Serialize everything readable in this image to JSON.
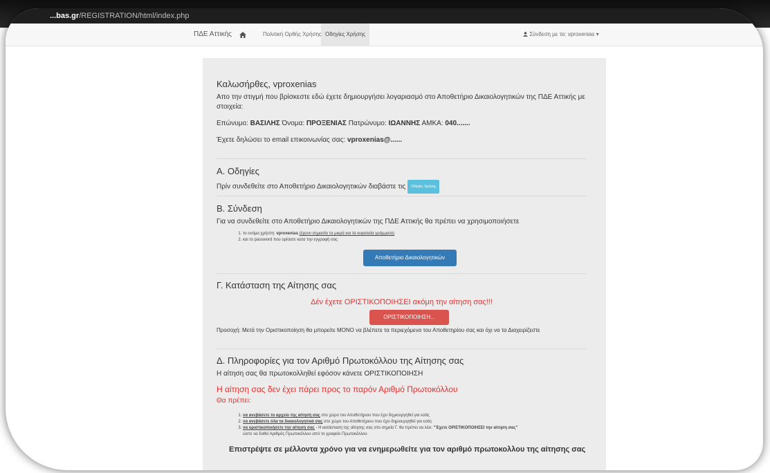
{
  "browser": {
    "url_domain": "...bas.gr",
    "url_path": "/REGISTRATION/html/index.php"
  },
  "navbar": {
    "brand": "ΠΔΕ Αττικής",
    "item_policy": "Πολιτική Ορθής Χρήσης",
    "item_guide": "Οδηγίες Χρήσης",
    "user": "Σύνδεση με τα: vproxenias"
  },
  "welcome": {
    "title": "Καλωσήρθες, vproxenias",
    "intro": "Απο την στιγμή που βρίσκεστε εδώ έχετε δημιουργήσει λογαριασμό στο Αποθετήριο Δικαιολογητικών της ΠΔΕ Αττικής με στοιχεία:",
    "surname_label": "Επώνυμο:",
    "surname": "ΒΑΣΙΛΗΣ",
    "name_label": "Όνομα:",
    "name": "ΠΡΟΞΕΝΙΑΣ",
    "father_label": "Πατρώνυμο:",
    "father": "ΙΩΑΝΝΗΣ",
    "amka_label": "ΑΜΚΑ:",
    "amka": "040.......",
    "email_label": "Έχετε δηλώσει το email επικοινωνίας σας:",
    "email": "vproxenias@......"
  },
  "section_a": {
    "title": "Α. Οδηγίες",
    "text": "Πρίν συνδεθείτε στο Αποθετήριο Δικαιολογητικών διαβάστε τις",
    "button": "Οδηγίες Χρήσης"
  },
  "section_b": {
    "title": "Β. Σύνδεση",
    "text": "Για να συνδεθείτε στο Αποθετήριο Δικαιολογητικών της ΠΔΕ Αττικής θα πρέπει να χρησιμοποιήσετε",
    "item1_prefix": "το ονόμα χρήστη:",
    "item1_user": "vproxenias",
    "item1_note": "(έχουν σημασία τα μικρά και τα κεφαλαία γράμματα)",
    "item2": "και το password που ορίσατε κατα την εγγραφή σας",
    "button": "Αποθετήριο Δικαιολογητικών"
  },
  "section_c": {
    "title": "Γ. Κατάσταση της Αίτησης σας",
    "alert": "Δέν έχετε ΟΡΙΣΤΙΚΟΠΟΙΗΣΕΙ ακόμη την αίτηση σας!!!",
    "button": "ΟΡΙΣΤΙΚΟΠΟΙΗΣΗ...",
    "note": "Προσοχή: Μετά την Οριστικοποίηση θα μπορείτε ΜΟΝΟ να βλέπετε τα περιεχόμενα του Αποθετηρίου σας και όχι να τα Διαχειρίζεστε"
  },
  "section_d": {
    "title": "Δ. Πληροφορίες για τον Αριθμό Πρωτοκόλλου της Αίτησης σας",
    "text": "Η αίτηση σας θα πρωτοκολληθεί εφόσον κάνετε ΟΡΙΣΤΙΚΟΠΟΙΗΣΗ",
    "alert": "Η αίτηση σας δεν έχει πάρει προς το παρόν Αριθμό Πρωτοκόλλου",
    "must": "Θα πρέπει:",
    "step1_bold": "να ανεβάσετε το αρχείο της αίτησή σας",
    "step1_rest": "στο χώρο του Αποθετήριου που έχει δημιουργηθεί για εσάς",
    "step2_bold": "να ανεβάσετε όλα τα δικαιολογητικά σας",
    "step2_rest": "στο χώρο του Αποθετήριου που έχει δημιουργηθεί για εσάς",
    "step3_bold": "να οριστικοποιήσετε την αίτηση σας",
    "step3_rest": "- Η κατάσταση της αίτησης σας στο σημείο Γ. θα πρέπει να λέει:",
    "step3_quote": "\"Έχετε ΟΡΙΣΤΙΚΟΠΟΙΗΣΕΙ την αίτηση σας\"",
    "step3_end": "ώστε να δοθεί Αριθμός Πρωτοκόλλου από το γραφείο Πρωτοκόλλου",
    "footer": "Επιστρέψτε σε μέλλοντα χρόνο για να ενημερωθείτε για τον αριθμό πρωτοκολλου της αίτησης σας"
  }
}
